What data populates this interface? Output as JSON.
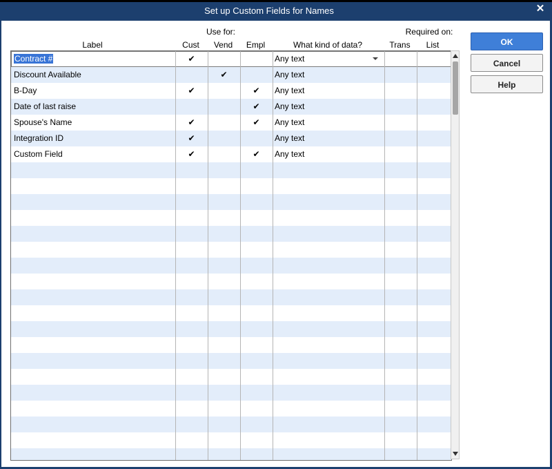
{
  "window": {
    "title": "Set up Custom Fields for Names"
  },
  "headers": {
    "label": "Label",
    "use_for": "Use for:",
    "cust": "Cust",
    "vend": "Vend",
    "empl": "Empl",
    "kind": "What kind of data?",
    "required_on": "Required on:",
    "trans": "Trans",
    "list": "List"
  },
  "buttons": {
    "ok": "OK",
    "cancel": "Cancel",
    "help": "Help"
  },
  "check_glyph": "✔",
  "rows": [
    {
      "label": "Contract #",
      "cust": "✔",
      "vend": "",
      "empl": "",
      "kind": "Any text"
    },
    {
      "label": "Discount Available",
      "cust": "",
      "vend": "✔",
      "empl": "",
      "kind": "Any text"
    },
    {
      "label": "B-Day",
      "cust": "✔",
      "vend": "",
      "empl": "✔",
      "kind": "Any text"
    },
    {
      "label": "Date of last raise",
      "cust": "",
      "vend": "",
      "empl": "✔",
      "kind": "Any text"
    },
    {
      "label": "Spouse's Name",
      "cust": "✔",
      "vend": "",
      "empl": "✔",
      "kind": "Any text"
    },
    {
      "label": "Integration ID",
      "cust": "✔",
      "vend": "",
      "empl": "",
      "kind": "Any text"
    },
    {
      "label": "Custom Field",
      "cust": "✔",
      "vend": "",
      "empl": "✔",
      "kind": "Any text"
    }
  ],
  "icons": {
    "close": "close-icon",
    "dropdown": "chevron-down-icon",
    "scroll_up": "scroll-up-arrow-icon",
    "scroll_down": "scroll-down-arrow-icon"
  },
  "colors": {
    "titlebar": "#1c3f6e",
    "row_alt": "#e3edfa",
    "selection": "#3874d6",
    "primary_button": "#3f7fd8"
  }
}
